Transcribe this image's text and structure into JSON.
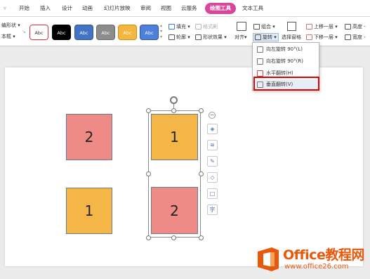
{
  "tabs": [
    "开始",
    "插入",
    "设计",
    "动画",
    "幻灯片放映",
    "审阅",
    "视图",
    "云服务",
    "绘图工具",
    "文本工具"
  ],
  "ribbon": {
    "shape_label": "编形状",
    "textbox_label": "本框",
    "style_swatches": [
      "Abc",
      "Abc",
      "Abc",
      "Abc",
      "Abc",
      "Abc"
    ],
    "fill_label": "填充",
    "outline_label": "轮廓",
    "format_painter_label": "格式刷",
    "shape_effects_label": "形状效果",
    "align_label": "对齐",
    "group_label": "组合",
    "rotate_label": "旋转",
    "selection_pane_label": "选择窗格",
    "bring_forward_label": "上移一层",
    "send_backward_label": "下移一层",
    "height_label": "高度",
    "width_label": "宽度"
  },
  "rotate_menu": {
    "items": [
      "向左旋转 90°(L)",
      "向右旋转 90°(R)",
      "水平翻转(H)",
      "垂直翻转(V)"
    ]
  },
  "slide": {
    "left_top": "2",
    "left_bottom": "1",
    "right_top": "1",
    "right_bottom": "2"
  },
  "watermark": {
    "title": "Office教程网",
    "url": "www.office26.com"
  },
  "colors": {
    "accent_tab": "#d9469b",
    "pink_square": "#ef8b86",
    "gold_square": "#f3b647",
    "highlight_box": "#e00000",
    "logo_orange": "#e8590c"
  }
}
